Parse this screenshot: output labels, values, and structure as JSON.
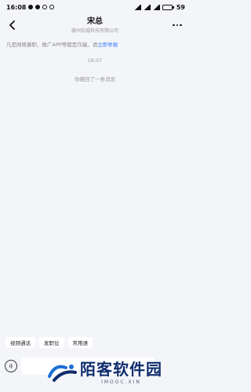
{
  "status_bar": {
    "time": "16:08",
    "battery": "59",
    "battery_level": 0.59
  },
  "header": {
    "contact_name": "宋总",
    "company": "赣州宏威科技有限公司"
  },
  "warning": {
    "text": "凡是网络兼职、推广APP等都是诈骗，请",
    "link": "立即举报"
  },
  "chat": {
    "timestamp": "16:07",
    "system_message": "你撤回了一条消息"
  },
  "quick_actions": [
    "视频通话",
    "发职位",
    "常用语"
  ],
  "watermark": {
    "text": "陌客软件园",
    "sub": "IMOOC.XIN"
  },
  "icons": {
    "back": "back-arrow-icon",
    "more": "more-dots-icon",
    "voice": "voice-icon"
  }
}
